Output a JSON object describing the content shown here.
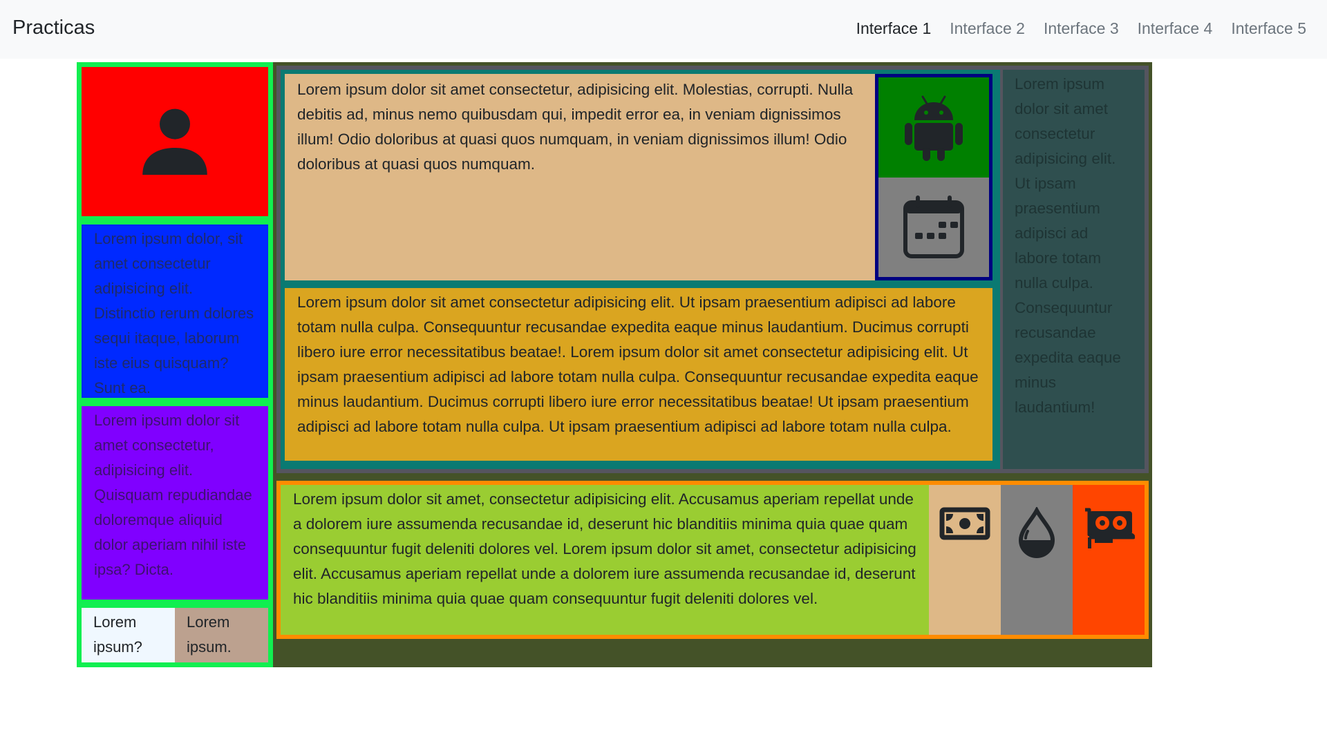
{
  "navbar": {
    "brand": "Practicas",
    "links": [
      "Interface 1",
      "Interface 2",
      "Interface 3",
      "Interface 4",
      "Interface 5"
    ],
    "active_index": 0
  },
  "left_column": {
    "avatar_icon": "person-fill-icon",
    "blue_text": "Lorem ipsum dolor, sit amet consectetur adipisicing elit. Distinctio rerum dolores sequi itaque, laborum iste eius quisquam? Sunt ea.",
    "purple_text": "Lorem ipsum dolor sit amet consectetur, adipisicing elit. Quisquam repudiandae doloremque aliquid dolor aperiam nihil iste ipsa? Dicta.",
    "pair_a_text": "Lorem ipsum?",
    "pair_b_text": "Lorem ipsum."
  },
  "main": {
    "tan_text": "Lorem ipsum dolor sit amet consectetur, adipisicing elit. Molestias, corrupti. Nulla debitis ad, minus nemo quibusdam qui, impedit error ea, in veniam dignissimos illum! Odio doloribus at quasi quos numquam, in veniam dignissimos illum! Odio doloribus at quasi quos numquam.",
    "gold_text": "Lorem ipsum dolor sit amet consectetur adipisicing elit. Ut ipsam praesentium adipisci ad labore totam nulla culpa. Consequuntur recusandae expedita eaque minus laudantium. Ducimus corrupti libero iure error necessitatibus beatae!. Lorem ipsum dolor sit amet consectetur adipisicing elit. Ut ipsam praesentium adipisci ad labore totam nulla culpa. Consequuntur recusandae expedita eaque minus laudantium. Ducimus corrupti libero iure error necessitatibus beatae! Ut ipsam praesentium adipisci ad labore totam nulla culpa. Ut ipsam praesentium adipisci ad labore totam nulla culpa.",
    "slate_text": "Lorem ipsum dolor sit amet consectetur adipisicing elit. Ut ipsam praesentium adipisci ad labore totam nulla culpa. Consequuntur recusandae expedita eaque minus laudantium!",
    "lime_text": "Lorem ipsum dolor sit amet, consectetur adipisicing elit. Accusamus aperiam repellat unde a dolorem iure assumenda recusandae id, deserunt hic blanditiis minima quia quae quam consequuntur fugit deleniti dolores vel. Lorem ipsum dolor sit amet, consectetur adipisicing elit. Accusamus aperiam repellat unde a dolorem iure assumenda recusandae id, deserunt hic blanditiis minima quia quae quam consequuntur fugit deleniti dolores vel.",
    "icons": [
      "android-icon",
      "calendar-icon",
      "cash-icon",
      "droplet-half-icon",
      "gpu-card-icon"
    ]
  },
  "colors": {
    "navbar_bg": "#f8f9fa",
    "left_border": "#11ef50",
    "avatar_bg": "#ff0000",
    "blue_bg": "#0029ff",
    "purple_bg": "#8000ff",
    "pair_a_bg": "#f0f8ff",
    "pair_b_bg": "#bca18f",
    "right_bg": "#445228",
    "tan_bg": "#deb887",
    "icon_col_border": "#000080",
    "android_bg": "#008000",
    "calendar_bg": "#808080",
    "gold_bg": "#daa520",
    "slate_bg": "#2f4f4f",
    "lower_border": "#ff8c00",
    "lime_bg": "#9acd32",
    "gpu_bg": "#ff4500"
  }
}
